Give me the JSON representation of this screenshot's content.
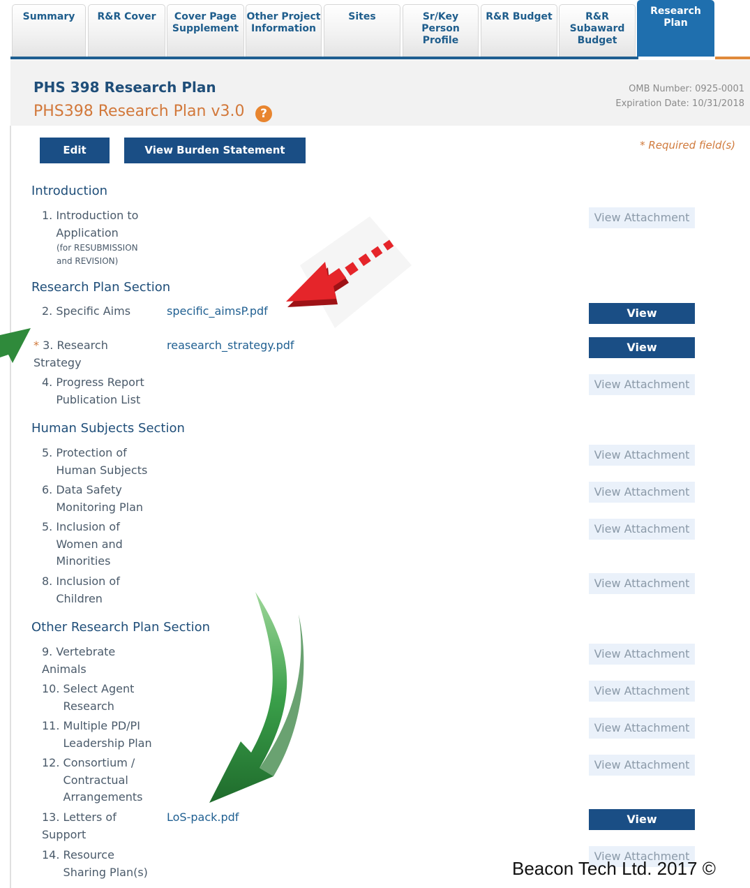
{
  "tabs": [
    {
      "label": "Summary"
    },
    {
      "label": "R&R Cover"
    },
    {
      "label": "Cover Page\nSupplement"
    },
    {
      "label": "Other Project\nInformation"
    },
    {
      "label": "Sites"
    },
    {
      "label": "Sr/Key\nPerson Profile"
    },
    {
      "label": "R&R Budget"
    },
    {
      "label": "R&R\nSubaward\nBudget"
    },
    {
      "label": "Research\nPlan",
      "active": true
    }
  ],
  "header": {
    "title": "PHS 398 Research Plan",
    "subtitle": "PHS398 Research Plan v3.0",
    "help_icon": "?",
    "omb_number": "OMB Number: 0925-0001",
    "expiration": "Expiration Date: 10/31/2018"
  },
  "toolbar": {
    "edit_label": "Edit",
    "burden_label": "View Burden Statement",
    "required_note": "* Required field(s)"
  },
  "sections": {
    "introduction": "Introduction",
    "research_plan": "Research Plan Section",
    "human_subjects": "Human Subjects Section",
    "other": "Other Research Plan Section"
  },
  "items": [
    {
      "num": "1.",
      "label": "Introduction to\nApplication",
      "note": "(for RESUBMISSION\nand REVISION)",
      "file": "",
      "attached": false
    },
    {
      "num": "2.",
      "label": "Specific Aims",
      "file": "specific_aimsP.pdf",
      "attached": true
    },
    {
      "num": "3.",
      "label": "Research\nStrategy",
      "file": "reasearch_strategy.pdf",
      "attached": true,
      "required": true
    },
    {
      "num": "4.",
      "label": "Progress Report\nPublication List",
      "file": "",
      "attached": false
    },
    {
      "num": "5.",
      "label": "Protection of\nHuman Subjects",
      "file": "",
      "attached": false
    },
    {
      "num": "6.",
      "label": "Data Safety\nMonitoring Plan",
      "file": "",
      "attached": false
    },
    {
      "num": "5.",
      "label": "Inclusion of\nWomen and\nMinorities",
      "file": "",
      "attached": false
    },
    {
      "num": "8.",
      "label": "Inclusion of\nChildren",
      "file": "",
      "attached": false
    },
    {
      "num": "9.",
      "label": "Vertebrate\nAnimals",
      "file": "",
      "attached": false
    },
    {
      "num": "10.",
      "label": "Select Agent\nResearch",
      "file": "",
      "attached": false
    },
    {
      "num": "11.",
      "label": "Multiple PD/PI\nLeadership Plan",
      "file": "",
      "attached": false
    },
    {
      "num": "12.",
      "label": "Consortium /\nContractual\nArrangements",
      "file": "",
      "attached": false
    },
    {
      "num": "13.",
      "label": "Letters of\nSupport",
      "file": "LoS-pack.pdf",
      "attached": true
    },
    {
      "num": "14.",
      "label": "Resource\nSharing Plan(s)",
      "file": "",
      "attached": false
    }
  ],
  "view_attachment_label": "View Attachment",
  "watermark": "Beacon Tech Ltd. 2017 ©",
  "colors": {
    "accent": "#1a4e85",
    "active_tab": "#1f6fae",
    "orange": "#d2783a",
    "disabled_button": "#eaf1fa",
    "red_arrow": "#e5252a",
    "green_arrow": "#2e8b3a"
  }
}
